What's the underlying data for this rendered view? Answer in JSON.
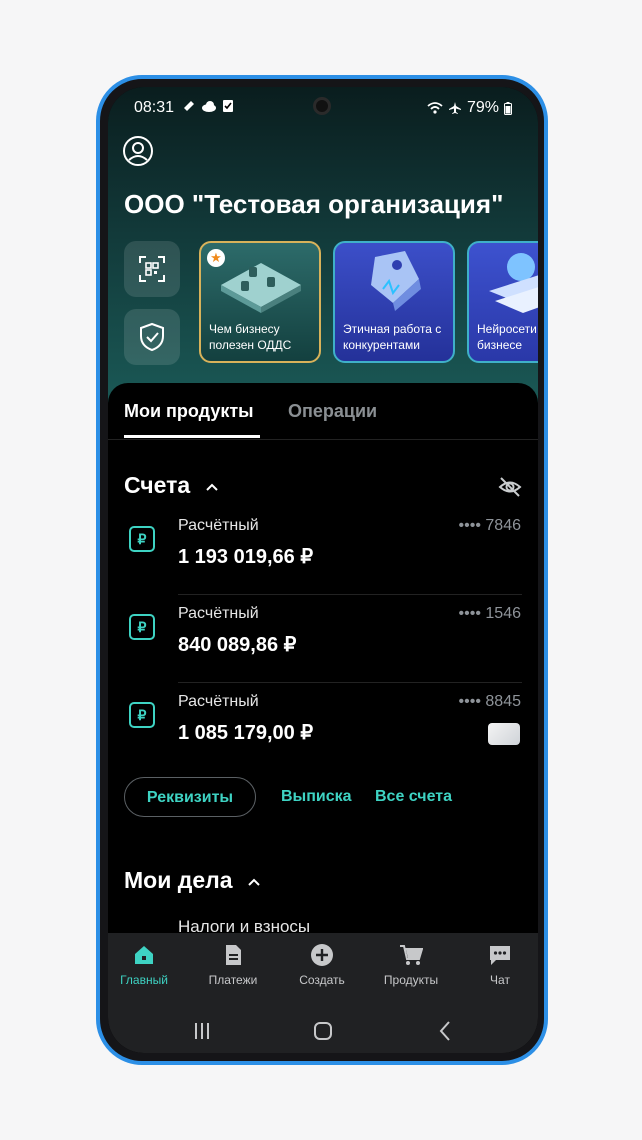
{
  "status": {
    "time": "08:31",
    "battery": "79%"
  },
  "header": {
    "org_name": "ООО \"Тестовая организация\""
  },
  "stories": [
    {
      "label": "Чем бизнесу полезен ОДДС"
    },
    {
      "label": "Этичная работа с конкурентами"
    },
    {
      "label": "Нейросети бизнесе"
    }
  ],
  "tabs": {
    "products": "Мои продукты",
    "operations": "Операции"
  },
  "accounts_section": {
    "title": "Счета",
    "items": [
      {
        "type": "Расчётный",
        "amount": "1 193 019,66 ₽",
        "mask": "•••• 7846"
      },
      {
        "type": "Расчётный",
        "amount": "840 089,86 ₽",
        "mask": "•••• 1546"
      },
      {
        "type": "Расчётный",
        "amount": "1 085 179,00 ₽",
        "mask": "•••• 8845"
      }
    ],
    "requisites_button": "Реквизиты",
    "statement_button": "Выписка",
    "all_accounts_button": "Все счета"
  },
  "tasks_section": {
    "title": "Мои дела",
    "items": [
      {
        "label": "Налоги и взносы"
      }
    ]
  },
  "bottom_nav": {
    "items": [
      {
        "label": "Главный",
        "icon": "home-icon"
      },
      {
        "label": "Платежи",
        "icon": "document-icon"
      },
      {
        "label": "Создать",
        "icon": "plus-circle-icon"
      },
      {
        "label": "Продукты",
        "icon": "cart-icon"
      },
      {
        "label": "Чат",
        "icon": "chat-icon"
      }
    ]
  },
  "colors": {
    "accent": "#3ed3c3",
    "frame": "#2c8fe6"
  }
}
